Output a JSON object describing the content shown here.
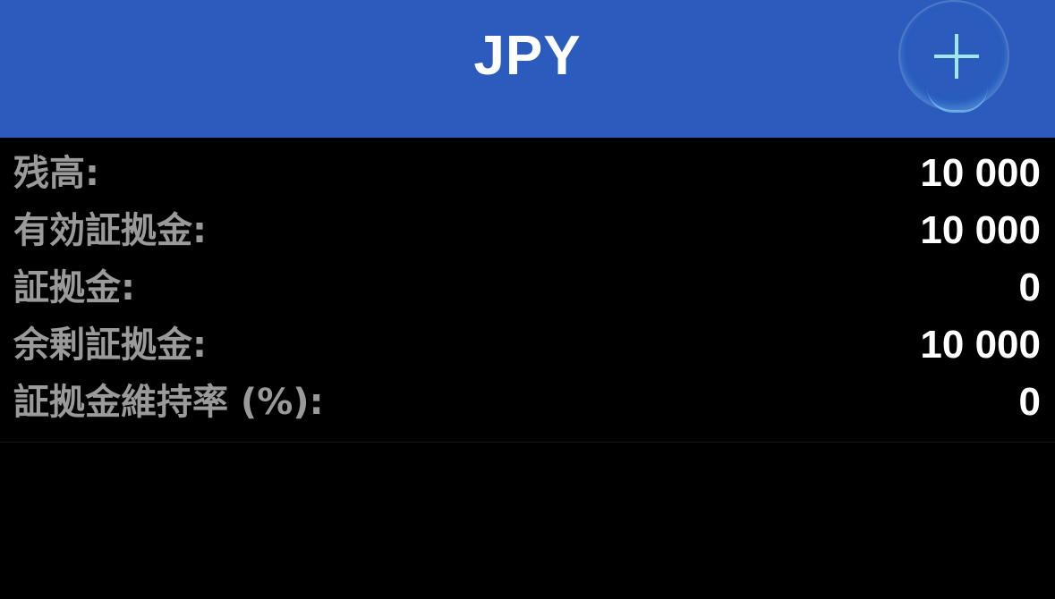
{
  "header": {
    "title": "JPY",
    "add_icon": "plus-icon",
    "add_icon_color": "#9fe6ee",
    "background": "#2a5bbd"
  },
  "account": {
    "rows": [
      {
        "label": "残高:",
        "value": "10 000"
      },
      {
        "label": "有効証拠金:",
        "value": "10 000"
      },
      {
        "label": "証拠金:",
        "value": "0"
      },
      {
        "label": "余剰証拠金:",
        "value": "10 000"
      },
      {
        "label": "証拠金維持率 (%):",
        "value": "0"
      }
    ]
  }
}
